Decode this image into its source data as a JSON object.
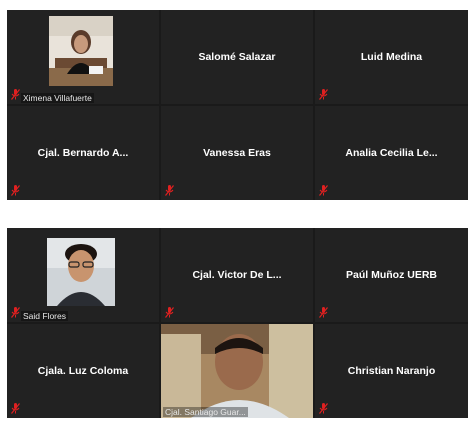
{
  "top_grid": {
    "tiles": [
      {
        "name": "Ximena Villafuerte",
        "display": "video-thumbnail",
        "muted": true
      },
      {
        "name": "Salomé Salazar",
        "display": "name",
        "muted": false
      },
      {
        "name": "Luid Medina",
        "display": "name",
        "muted": true
      },
      {
        "name": "Cjal. Bernardo A...",
        "display": "name",
        "muted": true
      },
      {
        "name": "Vanessa Eras",
        "display": "name",
        "muted": true
      },
      {
        "name": "Analia Cecilia Le...",
        "display": "name",
        "muted": true
      }
    ]
  },
  "bottom_grid": {
    "tiles": [
      {
        "name": "Said Flores",
        "display": "video-thumbnail",
        "muted": true
      },
      {
        "name": "Cjal. Victor De L...",
        "display": "name",
        "muted": true
      },
      {
        "name": "Paúl Muñoz UERB",
        "display": "name",
        "muted": true
      },
      {
        "name": "Cjala. Luz Coloma",
        "display": "name",
        "muted": true
      },
      {
        "name": "Cjal. Santiago Guar...",
        "display": "video-live",
        "muted": false
      },
      {
        "name": "Christian Naranjo",
        "display": "name",
        "muted": true
      }
    ]
  },
  "colors": {
    "tile_bg": "#222222",
    "grid_gap": "#1a1a1a",
    "mute_icon": "#e02020",
    "text": "#ffffff"
  },
  "icons": {
    "mute": "mic-muted-icon"
  }
}
